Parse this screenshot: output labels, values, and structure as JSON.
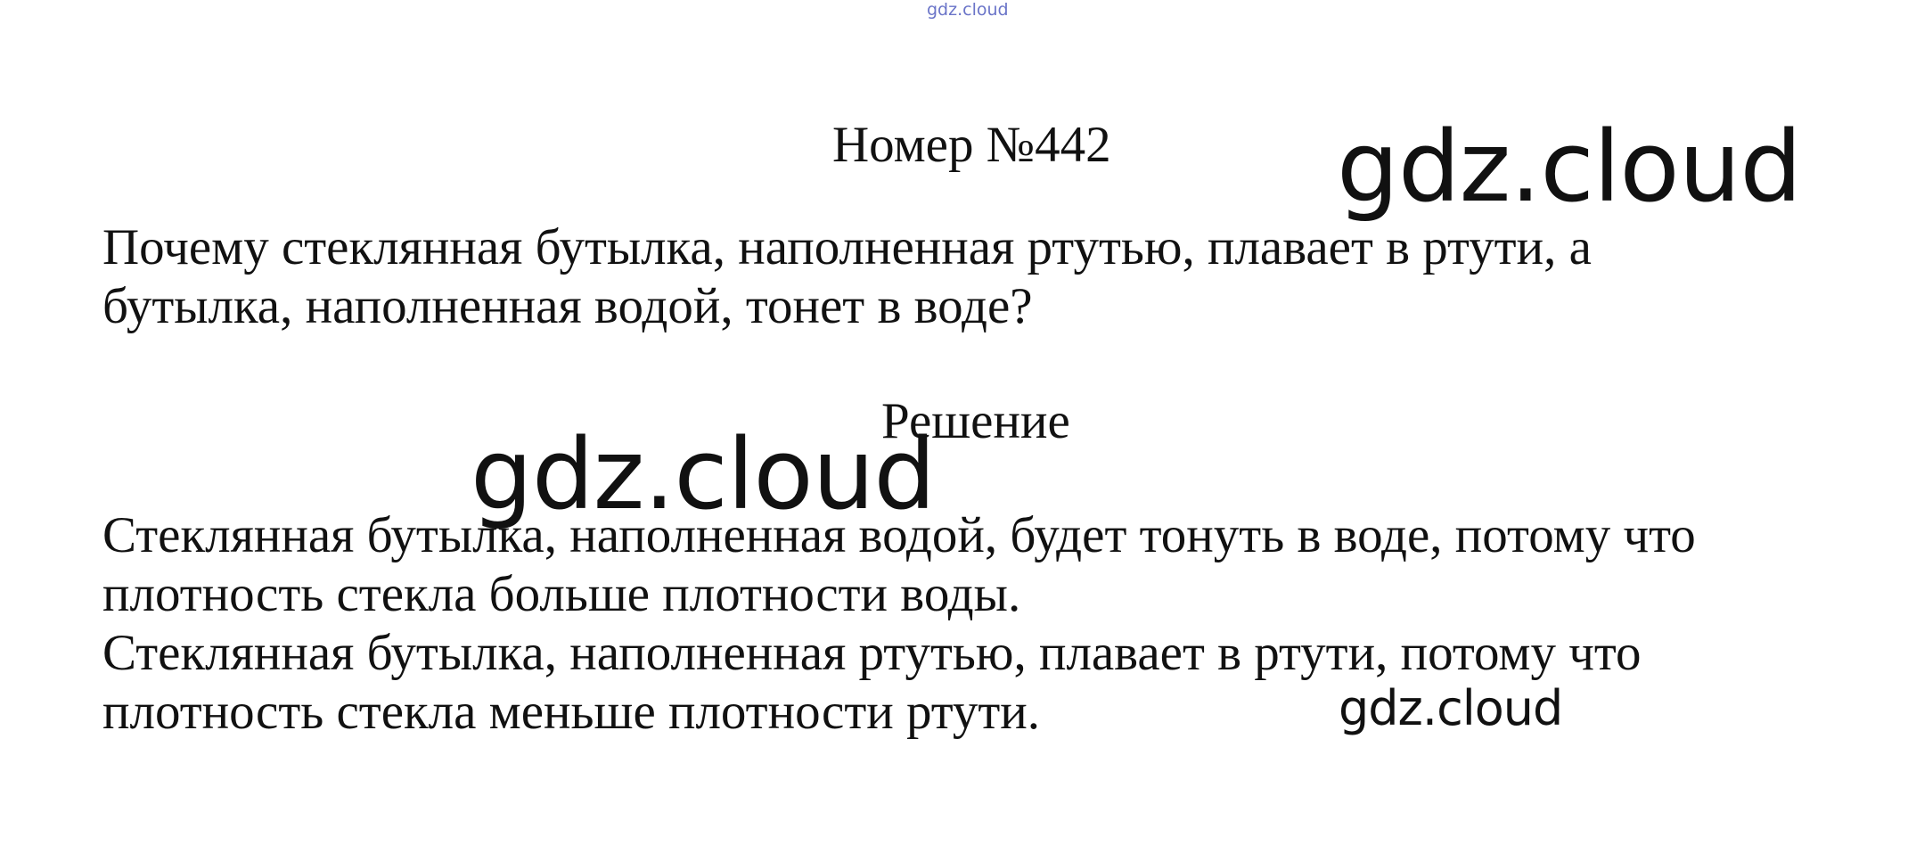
{
  "watermarks": {
    "top": "gdz.cloud",
    "primary": "gdz.cloud",
    "middle": "gdz.cloud",
    "bottom": "gdz.cloud"
  },
  "document": {
    "number_title": "Номер №442",
    "question_lines": [
      "Почему стеклянная бутылка, наполненная ртутью, плавает в ртути, а",
      "бутылка, наполненная водой, тонет в воде?"
    ],
    "solution_title": "Решение",
    "answer_lines": [
      "Стеклянная бутылка, наполненная водой, будет тонуть в воде, потому что",
      "плотность стекла больше плотности воды.",
      "Стеклянная бутылка, наполненная ртутью, плавает в ртути, потому что",
      "плотность стекла меньше плотности ртути."
    ]
  }
}
